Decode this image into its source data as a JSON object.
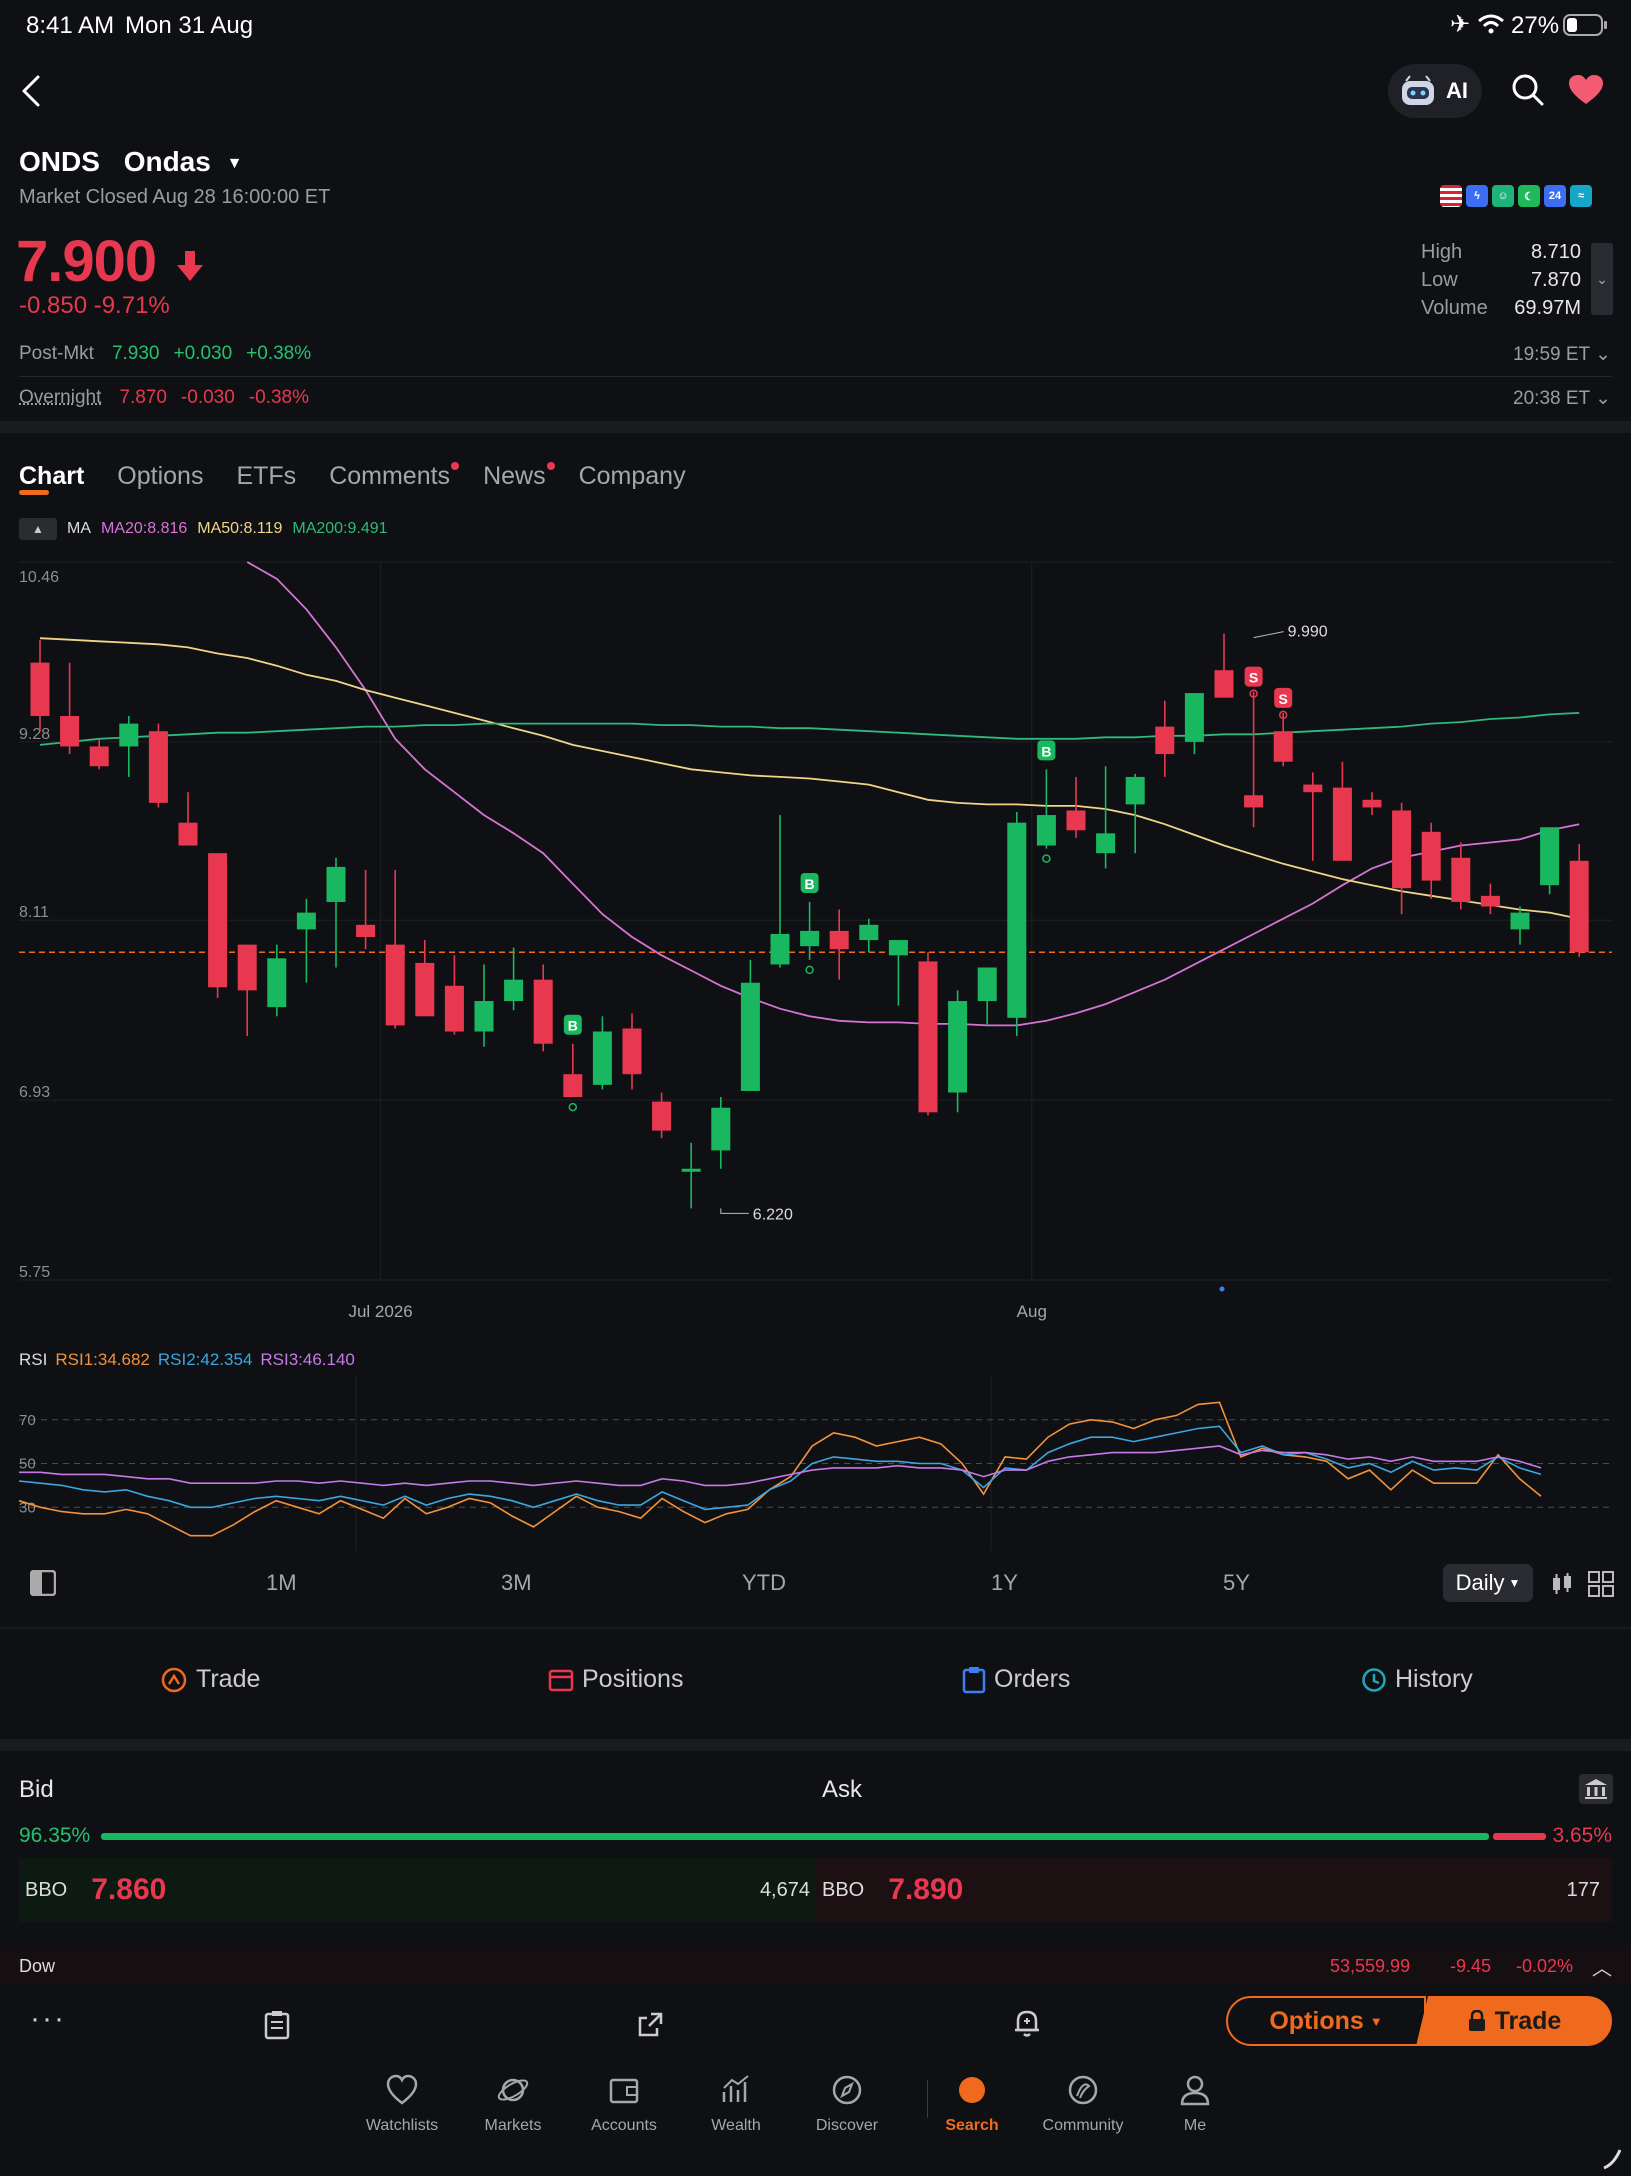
{
  "status_bar": {
    "time": "8:41 AM",
    "date": "Mon 31 Aug",
    "battery": "27%"
  },
  "header": {
    "ai_label": "AI"
  },
  "quote": {
    "symbol": "ONDS",
    "name": "Ondas",
    "market_status": "Market Closed Aug 28 16:00:00 ET",
    "price": "7.900",
    "change": "-0.850 -9.71%",
    "stats": [
      {
        "label": "High",
        "value": "8.710"
      },
      {
        "label": "Low",
        "value": "7.870"
      },
      {
        "label": "Volume",
        "value": "69.97M"
      }
    ],
    "post_market": {
      "label": "Post-Mkt",
      "price": "7.930",
      "change": "+0.030",
      "pct": "+0.38%",
      "time": "19:59 ET"
    },
    "overnight": {
      "label": "Overnight",
      "price": "7.870",
      "change": "-0.030",
      "pct": "-0.38%",
      "time": "20:38 ET"
    },
    "badges": [
      {
        "name": "us-flag-icon",
        "text": "",
        "color": "#c9d2e8"
      },
      {
        "name": "lightning-badge-icon",
        "text": "ϟ",
        "color": "#3d6df2"
      },
      {
        "name": "smile-badge-icon",
        "text": "☺",
        "color": "#1fb37a"
      },
      {
        "name": "moon-badge-icon",
        "text": "☾",
        "color": "#1fb85a"
      },
      {
        "name": "24h-badge-icon",
        "text": "24",
        "color": "#3d6df2"
      },
      {
        "name": "wave-badge-icon",
        "text": "≈",
        "color": "#14a7c9"
      }
    ]
  },
  "tabs": [
    {
      "label": "Chart",
      "active": true,
      "dot": false
    },
    {
      "label": "Options",
      "active": false,
      "dot": false
    },
    {
      "label": "ETFs",
      "active": false,
      "dot": false
    },
    {
      "label": "Comments",
      "active": false,
      "dot": true
    },
    {
      "label": "News",
      "active": false,
      "dot": true
    },
    {
      "label": "Company",
      "active": false,
      "dot": false
    }
  ],
  "ma": {
    "label": "MA",
    "ma20": "MA20:8.816",
    "ma50": "MA50:8.119",
    "ma200": "MA200:9.491"
  },
  "rsi": {
    "label": "RSI",
    "rsi1": "RSI1:34.682",
    "rsi2": "RSI2:42.354",
    "rsi3": "RSI3:46.140"
  },
  "colors": {
    "up": "#19b860",
    "down": "#e8384f",
    "ma20": "#d873d6",
    "ma50": "#efd58a",
    "ma200": "#2fb97c",
    "rsi1": "#f2923a",
    "rsi2": "#3aa7e0",
    "rsi3": "#c57ae8",
    "accent": "#f06a1d"
  },
  "chart_data": [
    {
      "type": "candlestick",
      "title": "",
      "y_ticks": [
        "10.46",
        "9.28",
        "8.11",
        "6.93",
        "5.75"
      ],
      "ylim": [
        5.75,
        10.46
      ],
      "x_ticks": [
        {
          "label": "Jul 2026",
          "index": 11
        },
        {
          "label": "Aug",
          "index": 33
        }
      ],
      "last_price": 7.9,
      "annotations": [
        {
          "text": "6.220",
          "index": 23,
          "value": 6.22
        },
        {
          "text": "9.990",
          "index": 41,
          "value": 9.99
        }
      ],
      "signals": [
        {
          "type": "B",
          "index": 18
        },
        {
          "type": "B",
          "index": 26
        },
        {
          "type": "B",
          "index": 34
        },
        {
          "type": "S",
          "index": 41
        },
        {
          "type": "S",
          "index": 42
        }
      ],
      "candles": [
        {
          "o": 9.8,
          "h": 9.95,
          "l": 9.35,
          "c": 9.45
        },
        {
          "o": 9.45,
          "h": 9.8,
          "l": 9.2,
          "c": 9.25
        },
        {
          "o": 9.25,
          "h": 9.3,
          "l": 9.1,
          "c": 9.12
        },
        {
          "o": 9.25,
          "h": 9.45,
          "l": 9.05,
          "c": 9.4
        },
        {
          "o": 9.35,
          "h": 9.4,
          "l": 8.85,
          "c": 8.88
        },
        {
          "o": 8.75,
          "h": 8.95,
          "l": 8.6,
          "c": 8.6
        },
        {
          "o": 8.55,
          "h": 8.55,
          "l": 7.6,
          "c": 7.67
        },
        {
          "o": 7.95,
          "h": 7.95,
          "l": 7.35,
          "c": 7.65
        },
        {
          "o": 7.54,
          "h": 7.95,
          "l": 7.48,
          "c": 7.86
        },
        {
          "o": 8.05,
          "h": 8.25,
          "l": 7.7,
          "c": 8.16
        },
        {
          "o": 8.23,
          "h": 8.52,
          "l": 7.8,
          "c": 8.46
        },
        {
          "o": 8.08,
          "h": 8.44,
          "l": 7.92,
          "c": 8.0
        },
        {
          "o": 7.95,
          "h": 8.44,
          "l": 7.4,
          "c": 7.42
        },
        {
          "o": 7.83,
          "h": 7.98,
          "l": 7.52,
          "c": 7.48
        },
        {
          "o": 7.68,
          "h": 7.88,
          "l": 7.36,
          "c": 7.38
        },
        {
          "o": 7.38,
          "h": 7.82,
          "l": 7.28,
          "c": 7.58
        },
        {
          "o": 7.58,
          "h": 7.93,
          "l": 7.52,
          "c": 7.72
        },
        {
          "o": 7.72,
          "h": 7.82,
          "l": 7.25,
          "c": 7.3
        },
        {
          "o": 7.1,
          "h": 7.3,
          "l": 6.95,
          "c": 6.95
        },
        {
          "o": 7.03,
          "h": 7.48,
          "l": 7.0,
          "c": 7.38
        },
        {
          "o": 7.4,
          "h": 7.5,
          "l": 7.0,
          "c": 7.1
        },
        {
          "o": 6.92,
          "h": 6.98,
          "l": 6.68,
          "c": 6.73
        },
        {
          "o": 6.46,
          "h": 6.65,
          "l": 6.22,
          "c": 6.48
        },
        {
          "o": 6.6,
          "h": 6.95,
          "l": 6.48,
          "c": 6.88
        },
        {
          "o": 6.99,
          "h": 7.85,
          "l": 6.99,
          "c": 7.7
        },
        {
          "o": 7.82,
          "h": 8.8,
          "l": 7.8,
          "c": 8.02
        },
        {
          "o": 7.94,
          "h": 8.23,
          "l": 7.85,
          "c": 8.04
        },
        {
          "o": 8.04,
          "h": 8.18,
          "l": 7.72,
          "c": 7.92
        },
        {
          "o": 7.98,
          "h": 8.12,
          "l": 7.9,
          "c": 8.08
        },
        {
          "o": 7.88,
          "h": 7.96,
          "l": 7.55,
          "c": 7.98
        },
        {
          "o": 7.84,
          "h": 7.9,
          "l": 6.83,
          "c": 6.85
        },
        {
          "o": 6.98,
          "h": 7.65,
          "l": 6.85,
          "c": 7.58
        },
        {
          "o": 7.58,
          "h": 7.79,
          "l": 7.42,
          "c": 7.8
        },
        {
          "o": 7.47,
          "h": 8.82,
          "l": 7.35,
          "c": 8.75
        },
        {
          "o": 8.6,
          "h": 9.1,
          "l": 8.58,
          "c": 8.8
        },
        {
          "o": 8.83,
          "h": 9.05,
          "l": 8.65,
          "c": 8.7
        },
        {
          "o": 8.55,
          "h": 9.12,
          "l": 8.45,
          "c": 8.68
        },
        {
          "o": 8.87,
          "h": 9.07,
          "l": 8.55,
          "c": 9.05
        },
        {
          "o": 9.38,
          "h": 9.55,
          "l": 9.05,
          "c": 9.2
        },
        {
          "o": 9.28,
          "h": 9.6,
          "l": 9.2,
          "c": 9.6
        },
        {
          "o": 9.75,
          "h": 9.99,
          "l": 9.6,
          "c": 9.57
        },
        {
          "o": 8.93,
          "h": 9.61,
          "l": 8.72,
          "c": 8.85
        },
        {
          "o": 9.35,
          "h": 9.47,
          "l": 9.12,
          "c": 9.15
        },
        {
          "o": 9.0,
          "h": 9.08,
          "l": 8.5,
          "c": 8.95
        },
        {
          "o": 8.98,
          "h": 9.15,
          "l": 8.55,
          "c": 8.5
        },
        {
          "o": 8.9,
          "h": 8.95,
          "l": 8.8,
          "c": 8.85
        },
        {
          "o": 8.83,
          "h": 8.88,
          "l": 8.15,
          "c": 8.32
        },
        {
          "o": 8.69,
          "h": 8.75,
          "l": 8.25,
          "c": 8.37
        },
        {
          "o": 8.52,
          "h": 8.62,
          "l": 8.18,
          "c": 8.23
        },
        {
          "o": 8.27,
          "h": 8.35,
          "l": 8.15,
          "c": 8.2
        },
        {
          "o": 8.05,
          "h": 8.2,
          "l": 7.95,
          "c": 8.16
        },
        {
          "o": 8.34,
          "h": 8.65,
          "l": 8.28,
          "c": 8.72
        },
        {
          "o": 8.5,
          "h": 8.61,
          "l": 7.87,
          "c": 7.9
        }
      ],
      "ma_series": [
        {
          "name": "MA20",
          "values": [
            null,
            null,
            null,
            null,
            null,
            null,
            null,
            10.46,
            10.35,
            10.15,
            9.9,
            9.62,
            9.3,
            9.1,
            8.95,
            8.8,
            8.68,
            8.55,
            8.35,
            8.15,
            8.0,
            7.88,
            7.78,
            7.68,
            7.6,
            7.53,
            7.48,
            7.45,
            7.44,
            7.44,
            7.43,
            7.43,
            7.42,
            7.42,
            7.45,
            7.5,
            7.56,
            7.64,
            7.72,
            7.82,
            7.92,
            8.02,
            8.12,
            8.22,
            8.34,
            8.45,
            8.52,
            8.56,
            8.6,
            8.62,
            8.64,
            8.7,
            8.74
          ]
        },
        {
          "name": "MA50",
          "values": [
            9.96,
            9.95,
            9.94,
            9.93,
            9.92,
            9.9,
            9.86,
            9.83,
            9.78,
            9.72,
            9.68,
            9.62,
            9.57,
            9.52,
            9.47,
            9.42,
            9.37,
            9.32,
            9.26,
            9.22,
            9.18,
            9.14,
            9.1,
            9.08,
            9.06,
            9.05,
            9.04,
            9.02,
            9.0,
            8.95,
            8.9,
            8.88,
            8.87,
            8.87,
            8.86,
            8.86,
            8.84,
            8.8,
            8.74,
            8.67,
            8.6,
            8.54,
            8.48,
            8.43,
            8.38,
            8.34,
            8.3,
            8.27,
            8.24,
            8.21,
            8.18,
            8.16,
            8.12
          ]
        },
        {
          "name": "MA200",
          "values": [
            9.26,
            9.28,
            9.3,
            9.31,
            9.32,
            9.33,
            9.34,
            9.34,
            9.35,
            9.36,
            9.37,
            9.38,
            9.38,
            9.39,
            9.39,
            9.4,
            9.4,
            9.4,
            9.4,
            9.4,
            9.4,
            9.39,
            9.39,
            9.38,
            9.38,
            9.37,
            9.37,
            9.36,
            9.35,
            9.34,
            9.33,
            9.32,
            9.31,
            9.3,
            9.3,
            9.3,
            9.31,
            9.31,
            9.32,
            9.32,
            9.33,
            9.33,
            9.34,
            9.35,
            9.36,
            9.37,
            9.38,
            9.4,
            9.41,
            9.43,
            9.44,
            9.46,
            9.47
          ]
        }
      ]
    },
    {
      "type": "line",
      "title": "",
      "ylim": [
        10,
        90
      ],
      "y_ticks": [
        "70",
        "50",
        "30"
      ],
      "series": [
        {
          "name": "RSI1",
          "values": [
            33,
            30,
            28,
            27,
            27,
            29,
            27,
            22,
            17,
            17,
            22,
            28,
            33,
            30,
            27,
            33,
            29,
            25,
            34,
            27,
            30,
            34,
            32,
            26,
            21,
            28,
            35,
            30,
            28,
            25,
            34,
            28,
            23,
            27,
            29,
            38,
            44,
            58,
            64,
            62,
            58,
            60,
            62,
            59,
            50,
            36,
            53,
            52,
            62,
            68,
            70,
            69,
            66,
            70,
            72,
            77,
            78,
            53,
            57,
            54,
            53,
            51,
            43,
            47,
            38,
            47,
            41,
            41,
            41,
            54,
            43,
            35
          ]
        },
        {
          "name": "RSI2",
          "values": [
            42,
            41,
            40,
            38,
            37,
            38,
            35,
            33,
            30,
            30,
            32,
            34,
            35,
            34,
            33,
            35,
            33,
            31,
            35,
            31,
            34,
            36,
            35,
            33,
            30,
            33,
            36,
            33,
            31,
            31,
            37,
            33,
            29,
            30,
            31,
            38,
            42,
            50,
            53,
            52,
            51,
            51,
            50,
            50,
            47,
            39,
            48,
            47,
            55,
            59,
            62,
            62,
            60,
            62,
            64,
            66,
            67,
            55,
            58,
            54,
            55,
            52,
            48,
            50,
            46,
            51,
            47,
            48,
            47,
            53,
            48,
            45
          ]
        },
        {
          "name": "RSI3",
          "values": [
            46,
            46,
            45,
            45,
            45,
            44,
            43,
            43,
            41,
            41,
            41,
            41,
            42,
            42,
            41,
            42,
            41,
            40,
            41,
            40,
            41,
            42,
            42,
            41,
            40,
            41,
            42,
            41,
            40,
            40,
            43,
            42,
            40,
            40,
            41,
            43,
            45,
            47,
            48,
            48,
            48,
            49,
            48,
            48,
            47,
            44,
            47,
            47,
            51,
            53,
            54,
            55,
            55,
            55,
            56,
            57,
            58,
            54,
            56,
            55,
            55,
            54,
            52,
            53,
            51,
            53,
            51,
            51,
            51,
            53,
            51,
            48
          ]
        }
      ]
    }
  ],
  "range_buttons": [
    "1M",
    "3M",
    "YTD",
    "1Y",
    "5Y"
  ],
  "interval": "Daily",
  "actions": [
    {
      "label": "Trade",
      "color": "#f06a1d"
    },
    {
      "label": "Positions",
      "color": "#e8384f"
    },
    {
      "label": "Orders",
      "color": "#3d7ef2"
    },
    {
      "label": "History",
      "color": "#1fa8b8"
    }
  ],
  "orderbook": {
    "bid_label": "Bid",
    "ask_label": "Ask",
    "bid_pct": "96.35%",
    "ask_pct": "3.65%",
    "bid_share": 0.9635,
    "bbo_label": "BBO",
    "bid_price": "7.860",
    "bid_size": "4,674",
    "ask_price": "7.890",
    "ask_size": "177"
  },
  "index_ticker": {
    "name": "Dow",
    "value": "53,559.99",
    "change": "-9.45",
    "pct": "-0.02%"
  },
  "buttons": {
    "options": "Options",
    "trade": "Trade"
  },
  "nav": [
    {
      "label": "Watchlists",
      "icon": "heart-icon",
      "active": false
    },
    {
      "label": "Markets",
      "icon": "planet-icon",
      "active": false
    },
    {
      "label": "Accounts",
      "icon": "wallet-icon",
      "active": false
    },
    {
      "label": "Wealth",
      "icon": "growth-icon",
      "active": false
    },
    {
      "label": "Discover",
      "icon": "compass-icon",
      "active": false
    },
    {
      "label": "Search",
      "icon": "search-icon",
      "active": true
    },
    {
      "label": "Community",
      "icon": "community-icon",
      "active": false
    },
    {
      "label": "Me",
      "icon": "person-icon",
      "active": false
    }
  ]
}
